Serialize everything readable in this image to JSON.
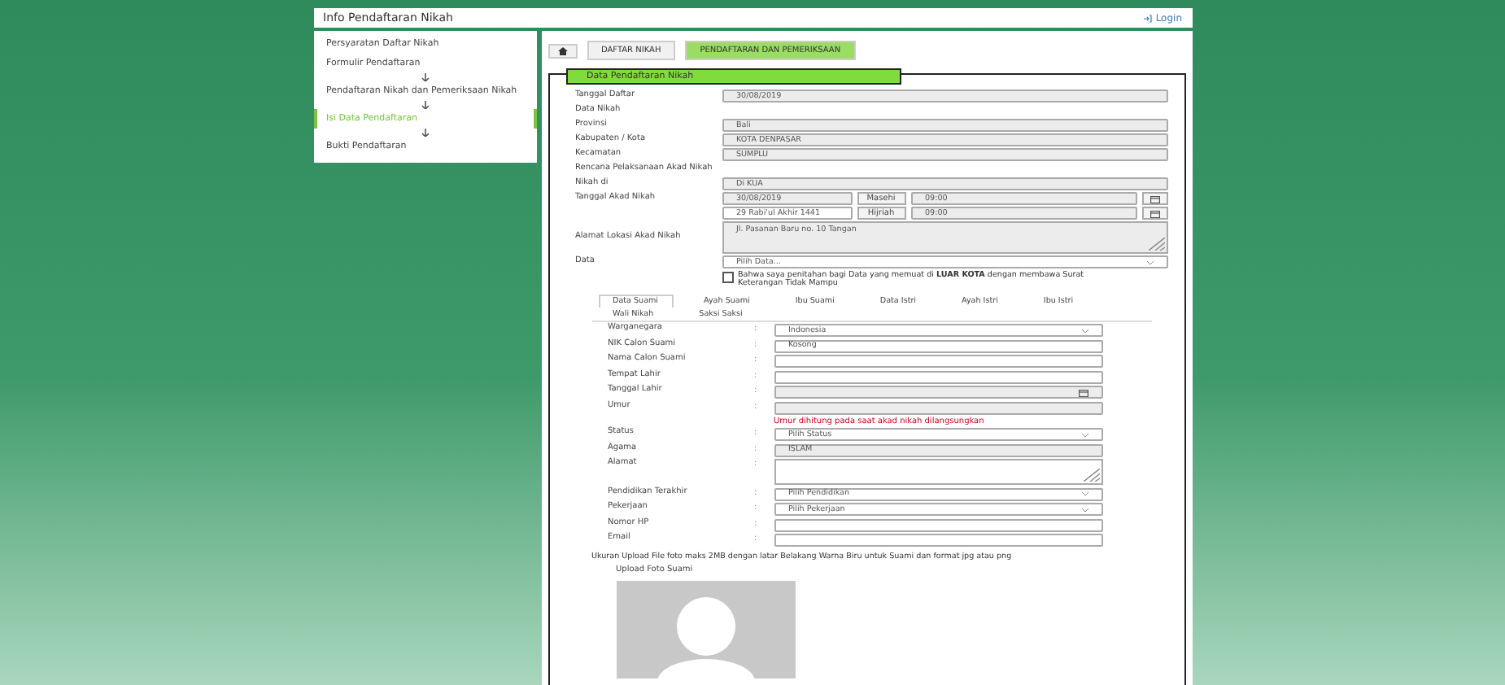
{
  "header": {
    "title": "Info Pendaftaran Nikah",
    "login": "Login"
  },
  "sidebar": {
    "items": [
      {
        "label": "Persyaratan Daftar Nikah",
        "selected": false,
        "kind": "link"
      },
      {
        "label": "Formulir Pendaftaran",
        "selected": false,
        "kind": "link"
      },
      {
        "kind": "arrow"
      },
      {
        "label": "Pendaftaran Nikah dan Pemeriksaan Nikah",
        "selected": false,
        "kind": "link"
      },
      {
        "kind": "arrow"
      },
      {
        "label": "Isi Data Pendaftaran",
        "selected": true,
        "kind": "link"
      },
      {
        "kind": "arrow"
      },
      {
        "label": "Bukti Pendaftaran",
        "selected": false,
        "kind": "link"
      }
    ]
  },
  "breadcrumb": [
    {
      "label": "DAFTAR NIKAH",
      "selected": false
    },
    {
      "label": "PENDAFTARAN DAN PEMERIKSAAN",
      "selected": true
    }
  ],
  "legend": "Data Pendaftaran Nikah",
  "form": [
    {
      "kind": "input",
      "label": "Tanggal Daftar",
      "value": "30/08/2019"
    },
    {
      "kind": "heading",
      "label": "Data Nikah"
    },
    {
      "kind": "input",
      "label": "Provinsi",
      "value": "Bali"
    },
    {
      "kind": "input",
      "label": "Kabupaten / Kota",
      "value": "KOTA DENPASAR"
    },
    {
      "kind": "input",
      "label": "Kecamatan",
      "value": "SUMPLU"
    },
    {
      "kind": "heading",
      "label": "Rencana Pelaksanaan Akad Nikah"
    },
    {
      "kind": "input",
      "label": "Nikah di",
      "value": "Di KUA"
    },
    {
      "kind": "datetime",
      "label": "Tanggal Akad Nikah",
      "date": "30/08/2019",
      "era": "Masehi",
      "time": "09:00"
    },
    {
      "kind": "datetime",
      "date": "29 Rabi'ul Akhir 1441",
      "era": "Hijriah",
      "time": "09:00"
    },
    {
      "kind": "textarea",
      "label": "Alamat Lokasi Akad Nikah",
      "value": "Jl. Pasanan Baru no. 10 Tangan"
    },
    {
      "kind": "select",
      "label": "Data",
      "value": "Pilih Data..."
    }
  ],
  "consent": {
    "checked": false,
    "text": "Bahwa saya penitahan bagi Data yang memuat di **LUAR KOTA** dengan membawa Surat Keterangan Tidak Mampu"
  },
  "tabs": [
    {
      "label": "Data Suami",
      "selected": true
    },
    {
      "label": "Ayah Suami",
      "selected": false
    },
    {
      "label": "Ibu Suami",
      "selected": false
    },
    {
      "label": "Data Istri",
      "selected": false
    },
    {
      "label": "Ayah Istri",
      "selected": false
    },
    {
      "label": "Ibu Istri",
      "selected": false
    },
    {
      "label": "Wali Nikah",
      "selected": false
    },
    {
      "label": "Saksi Saksi",
      "selected": false
    }
  ],
  "person": [
    {
      "kind": "select",
      "label": "Warganegara",
      "colon": ":",
      "value": "Indonesia"
    },
    {
      "kind": "input",
      "label": "NIK Calon Suami",
      "colon": ":",
      "placeholder": "Kosong"
    },
    {
      "kind": "input",
      "label": "Nama Calon Suami",
      "colon": ":"
    },
    {
      "kind": "input",
      "label": "Tempat Lahir",
      "colon": ":"
    },
    {
      "kind": "date",
      "label": "Tanggal Lahir",
      "colon": ":"
    },
    {
      "kind": "readonly",
      "label": "Umur",
      "colon": ":",
      "note": "Umur dihitung pada saat akad nikah dilangsungkan"
    },
    {
      "kind": "select",
      "label": "Status",
      "colon": ":",
      "value": "Pilih Status"
    },
    {
      "kind": "readonly",
      "label": "Agama",
      "colon": ":",
      "value": "ISLAM"
    },
    {
      "kind": "textarea",
      "label": "Alamat",
      "colon": ":"
    },
    {
      "kind": "select",
      "label": "Pendidikan Terakhir",
      "colon": ":",
      "value": "Pilih Pendidikan"
    },
    {
      "kind": "select",
      "label": "Pekerjaan",
      "colon": ":",
      "value": "Pilih Pekerjaan"
    },
    {
      "kind": "input",
      "label": "Nomor HP",
      "colon": ":"
    },
    {
      "kind": "input",
      "label": "Email",
      "colon": ":"
    }
  ],
  "upload_note": "Ukuran Upload File foto maks 2MB dengan latar Belakang Warna Biru untuk Suami dan format jpg atau png",
  "upload_label": "Upload Foto Suami"
}
